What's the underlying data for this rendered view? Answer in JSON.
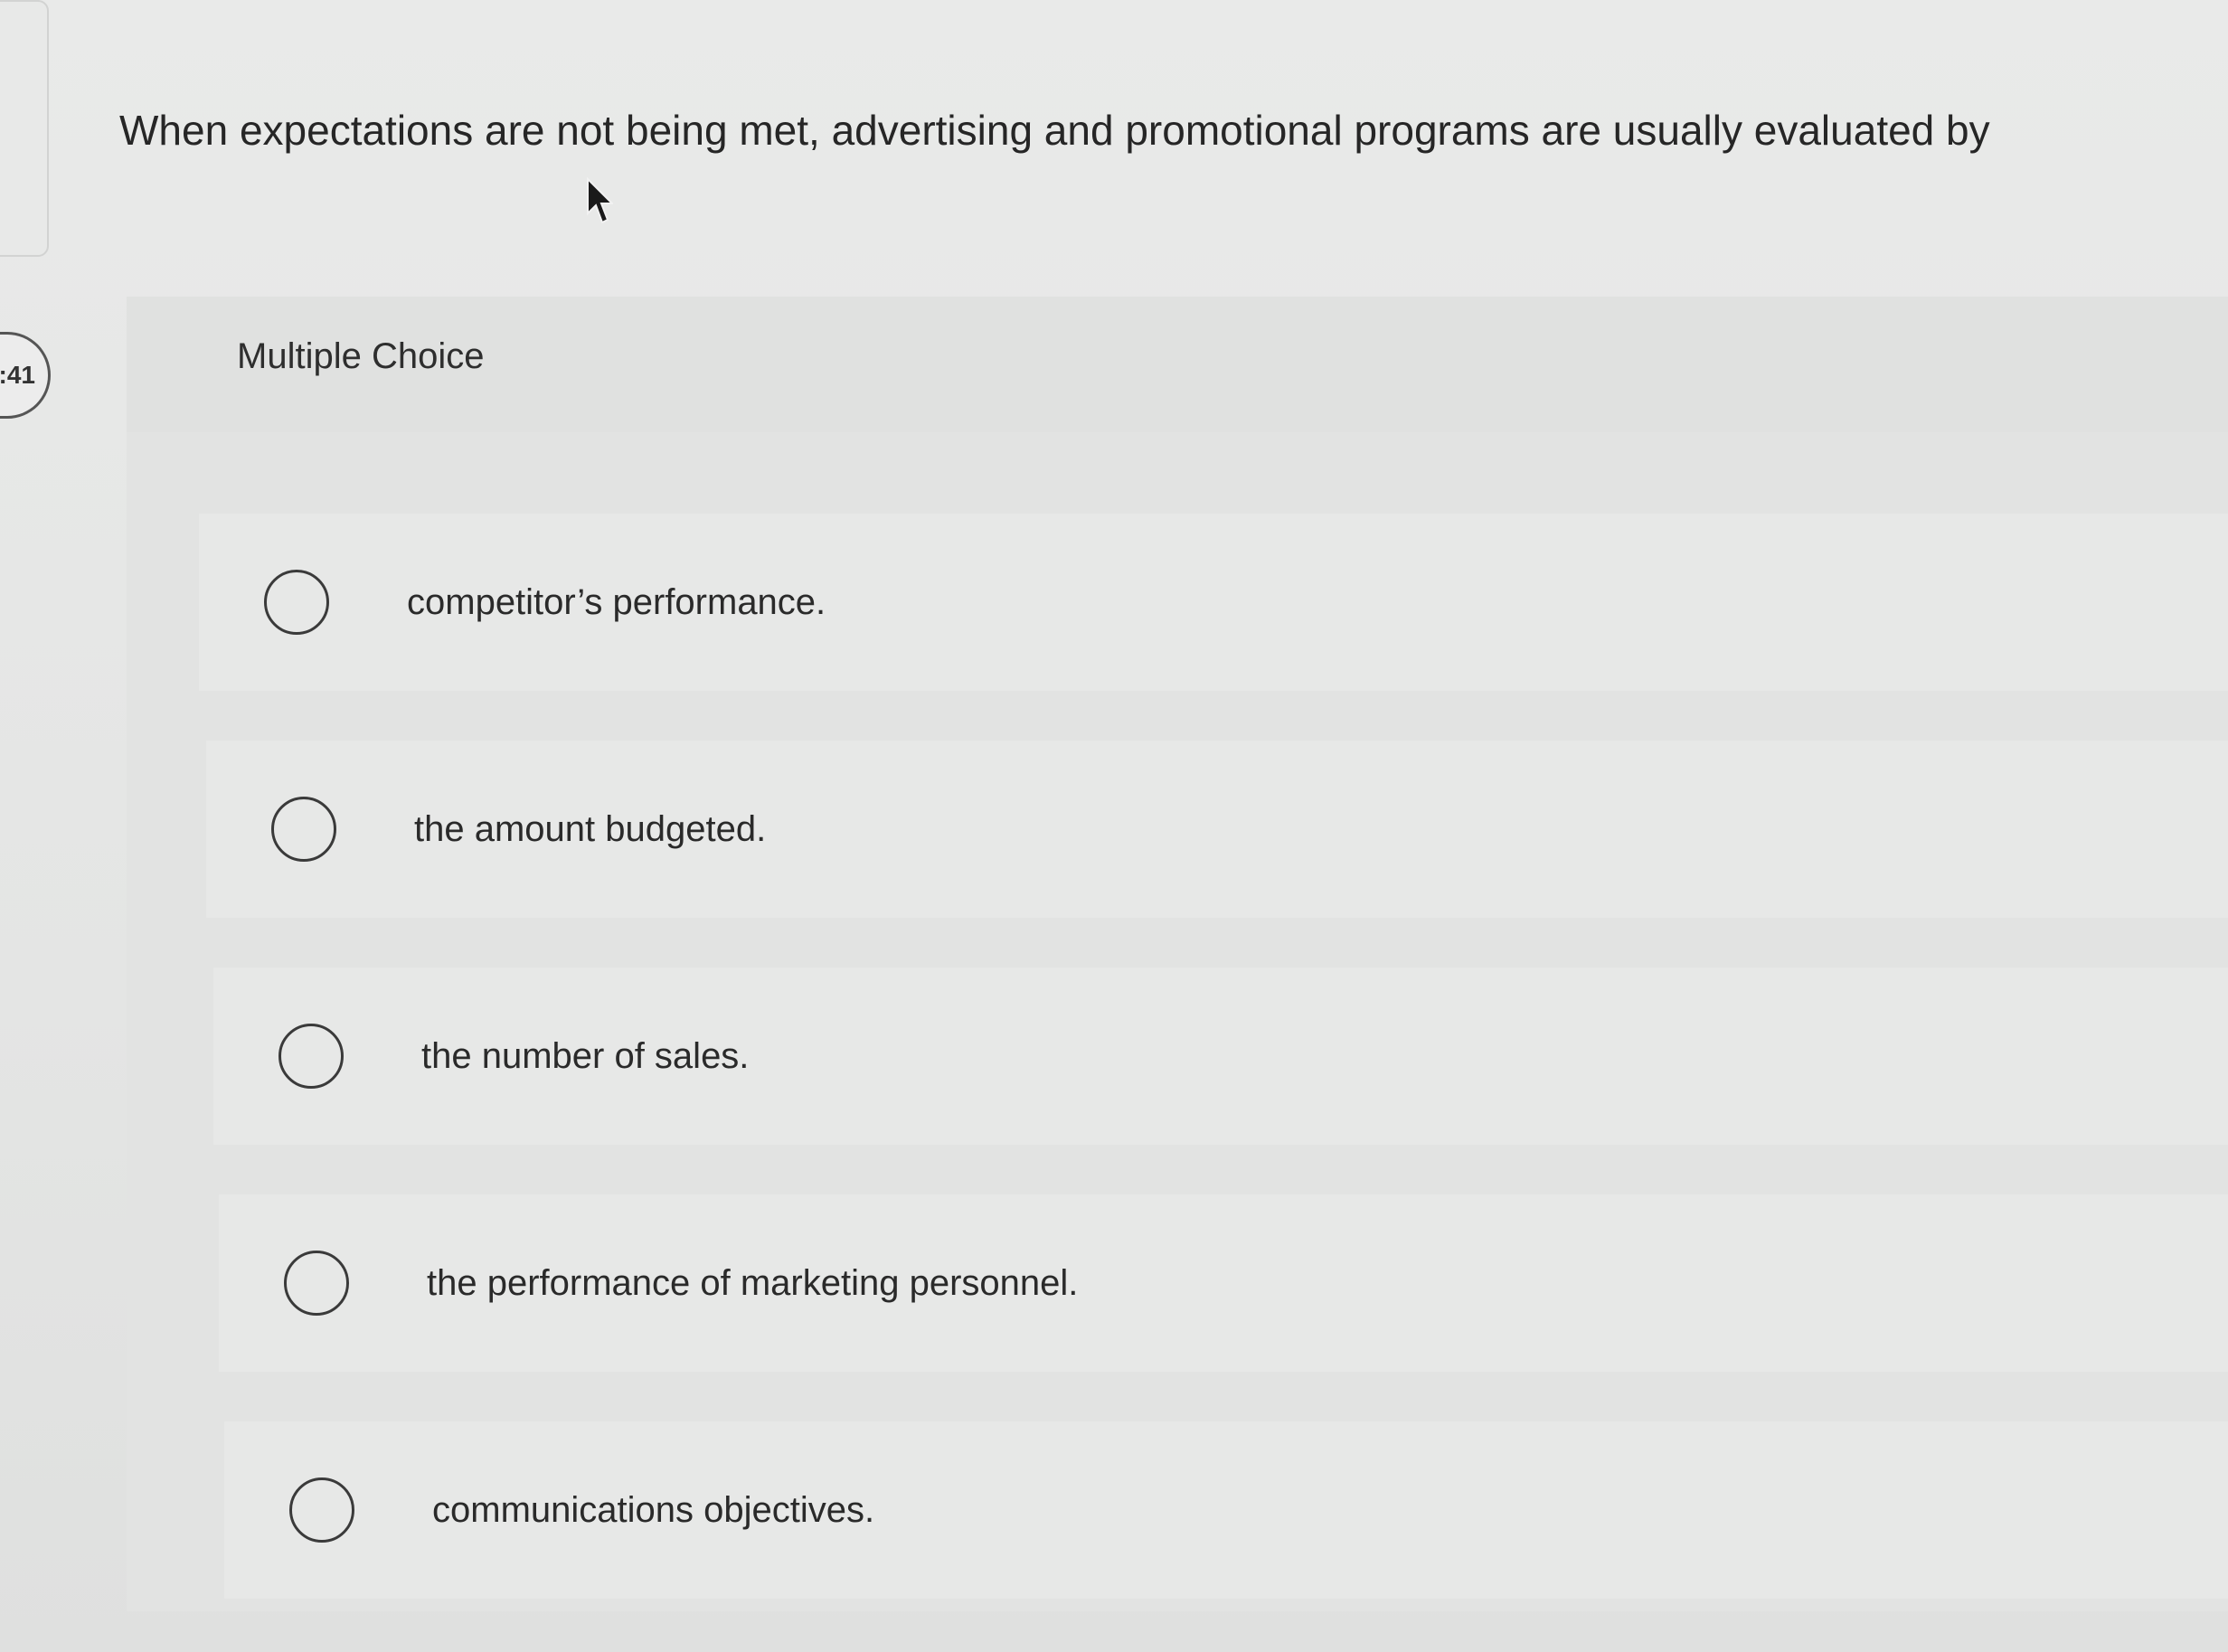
{
  "timer": {
    "text": ":41"
  },
  "question": {
    "text": "When expectations are not being met, advertising and promotional programs are usually evaluated by"
  },
  "card": {
    "label": "Multiple Choice",
    "choices": [
      {
        "label": "competitor’s performance."
      },
      {
        "label": "the amount budgeted."
      },
      {
        "label": "the number of sales."
      },
      {
        "label": "the performance of marketing personnel."
      },
      {
        "label": "communications objectives."
      }
    ]
  },
  "icons": {
    "cursor": "mouse-pointer-icon",
    "radio": "radio-unselected-icon"
  }
}
